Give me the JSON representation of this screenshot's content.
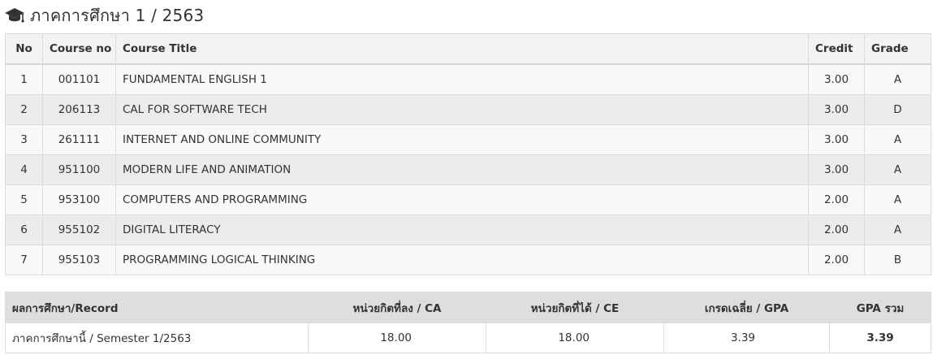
{
  "heading": {
    "icon": "graduation-cap-icon",
    "title": "ภาคการศึกษา 1 / 2563"
  },
  "courses": {
    "headers": {
      "no": "No",
      "course_no": "Course no",
      "course_title": "Course Title",
      "credit": "Credit",
      "grade": "Grade"
    },
    "rows": [
      {
        "no": "1",
        "course_no": "001101",
        "title": "FUNDAMENTAL ENGLISH 1",
        "credit": "3.00",
        "grade": "A"
      },
      {
        "no": "2",
        "course_no": "206113",
        "title": "CAL FOR SOFTWARE TECH",
        "credit": "3.00",
        "grade": "D"
      },
      {
        "no": "3",
        "course_no": "261111",
        "title": "INTERNET AND ONLINE COMMUNITY",
        "credit": "3.00",
        "grade": "A"
      },
      {
        "no": "4",
        "course_no": "951100",
        "title": "MODERN LIFE AND ANIMATION",
        "credit": "3.00",
        "grade": "A"
      },
      {
        "no": "5",
        "course_no": "953100",
        "title": "COMPUTERS AND PROGRAMMING",
        "credit": "2.00",
        "grade": "A"
      },
      {
        "no": "6",
        "course_no": "955102",
        "title": "DIGITAL LITERACY",
        "credit": "2.00",
        "grade": "A"
      },
      {
        "no": "7",
        "course_no": "955103",
        "title": "PROGRAMMING LOGICAL THINKING",
        "credit": "2.00",
        "grade": "B"
      }
    ]
  },
  "summary": {
    "headers": {
      "record": "ผลการศึกษา/Record",
      "ca": "หน่วยกิตที่ลง / CA",
      "ce": "หน่วยกิตที่ได้ / CE",
      "gpa": "เกรดเฉลี่ย / GPA",
      "gpa_total": "GPA รวม"
    },
    "row": {
      "label": "ภาคการศึกษานี้ / Semester 1/2563",
      "ca": "18.00",
      "ce": "18.00",
      "gpa": "3.39",
      "gpa_total": "3.39"
    }
  }
}
